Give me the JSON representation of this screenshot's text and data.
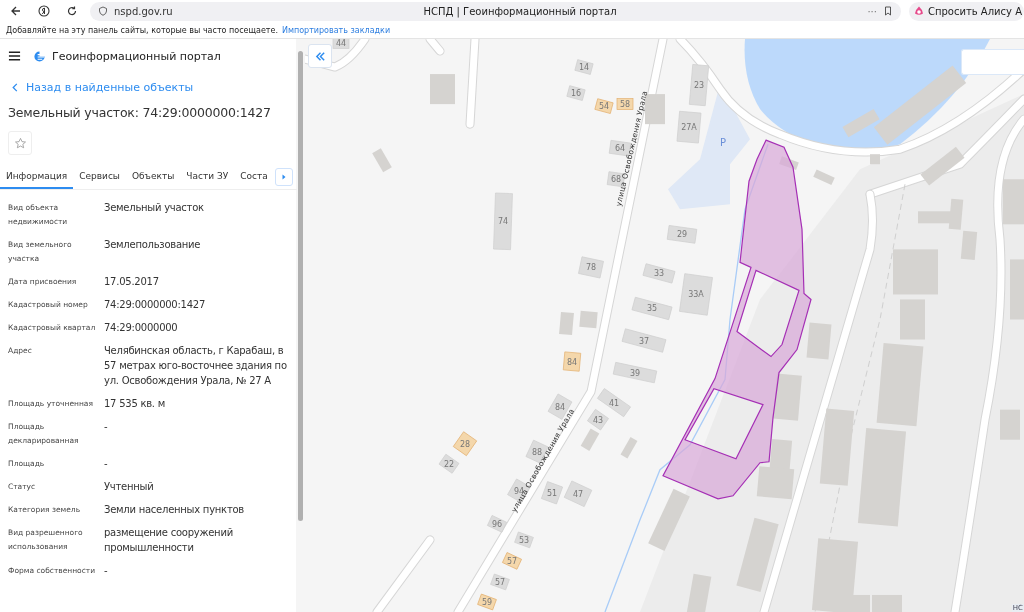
{
  "browser": {
    "address": "nspd.gov.ru",
    "title": "НСПД | Геоинформационный портал",
    "menu": "···",
    "assistant": "Спросить Алису А"
  },
  "bookmarks_bar": {
    "text": "Добавляйте на эту панель сайты, которые вы часто посещаете.",
    "link": "Импортировать закладки"
  },
  "sidebar": {
    "app_title": "Геоинформационный портал",
    "back_link": "Назад в найденные объекты",
    "title": "Земельный участок: 74:29:0000000:1427",
    "favorite": false,
    "tabs": [
      {
        "label": "Информация",
        "selected": true
      },
      {
        "label": "Сервисы",
        "selected": false
      },
      {
        "label": "Объекты",
        "selected": false
      },
      {
        "label": "Части ЗУ",
        "selected": false
      },
      {
        "label": "Соста",
        "selected": false
      }
    ],
    "fields": [
      {
        "label": "Вид объекта недвижимости",
        "value": "Земельный участок"
      },
      {
        "label": "Вид земельного участка",
        "value": "Землепользование"
      },
      {
        "label": "Дата присвоения",
        "value": "17.05.2017"
      },
      {
        "label": "Кадастровый номер",
        "value": "74:29:0000000:1427"
      },
      {
        "label": "Кадастровый квартал",
        "value": "74:29:0000000"
      },
      {
        "label": "Адрес",
        "value": "Челябинская область, г Карабаш, в 57 метрах юго-восточнее здания по ул. Освобождения Урала, № 27 А"
      },
      {
        "label": "Площадь уточненная",
        "value": "17 535 кв. м"
      },
      {
        "label": "Площадь декларированная",
        "value": "-"
      },
      {
        "label": "Площадь",
        "value": "-"
      },
      {
        "label": "Статус",
        "value": "Учтенный"
      },
      {
        "label": "Категория земель",
        "value": "Земли населенных пунктов"
      },
      {
        "label": "Вид разрешенного использования",
        "value": "размещение сооружений промышленности"
      },
      {
        "label": "Форма собственности",
        "value": "-"
      }
    ]
  },
  "map": {
    "houses": [
      {
        "number": "44",
        "highlighted": false
      },
      {
        "number": "14",
        "highlighted": false
      },
      {
        "number": "16",
        "highlighted": false
      },
      {
        "number": "54",
        "highlighted": true
      },
      {
        "number": "58",
        "highlighted": true
      },
      {
        "number": "64",
        "highlighted": false
      },
      {
        "number": "68",
        "highlighted": false
      },
      {
        "number": "74",
        "highlighted": false
      },
      {
        "number": "78",
        "highlighted": false
      },
      {
        "number": "33",
        "highlighted": false
      },
      {
        "number": "35",
        "highlighted": false
      },
      {
        "number": "37",
        "highlighted": false
      },
      {
        "number": "39",
        "highlighted": false
      },
      {
        "number": "84",
        "highlighted": true
      },
      {
        "number": "84",
        "highlighted": false
      },
      {
        "number": "41",
        "highlighted": false
      },
      {
        "number": "43",
        "highlighted": false
      },
      {
        "number": "28",
        "highlighted": true
      },
      {
        "number": "22",
        "highlighted": false
      },
      {
        "number": "88",
        "highlighted": false
      },
      {
        "number": "94",
        "highlighted": false
      },
      {
        "number": "51",
        "highlighted": false
      },
      {
        "number": "47",
        "highlighted": false
      },
      {
        "number": "96",
        "highlighted": false
      },
      {
        "number": "53",
        "highlighted": false
      },
      {
        "number": "57",
        "highlighted": true
      },
      {
        "number": "57",
        "highlighted": false
      },
      {
        "number": "59",
        "highlighted": true
      },
      {
        "number": "23",
        "highlighted": false
      },
      {
        "number": "27А",
        "highlighted": false
      },
      {
        "number": "29",
        "highlighted": false
      },
      {
        "number": "33А",
        "highlighted": false
      }
    ],
    "streets": [
      "улица Освобождения Урала",
      "улица Освобождения Урала"
    ],
    "parking": "P",
    "attribution": "НС"
  }
}
